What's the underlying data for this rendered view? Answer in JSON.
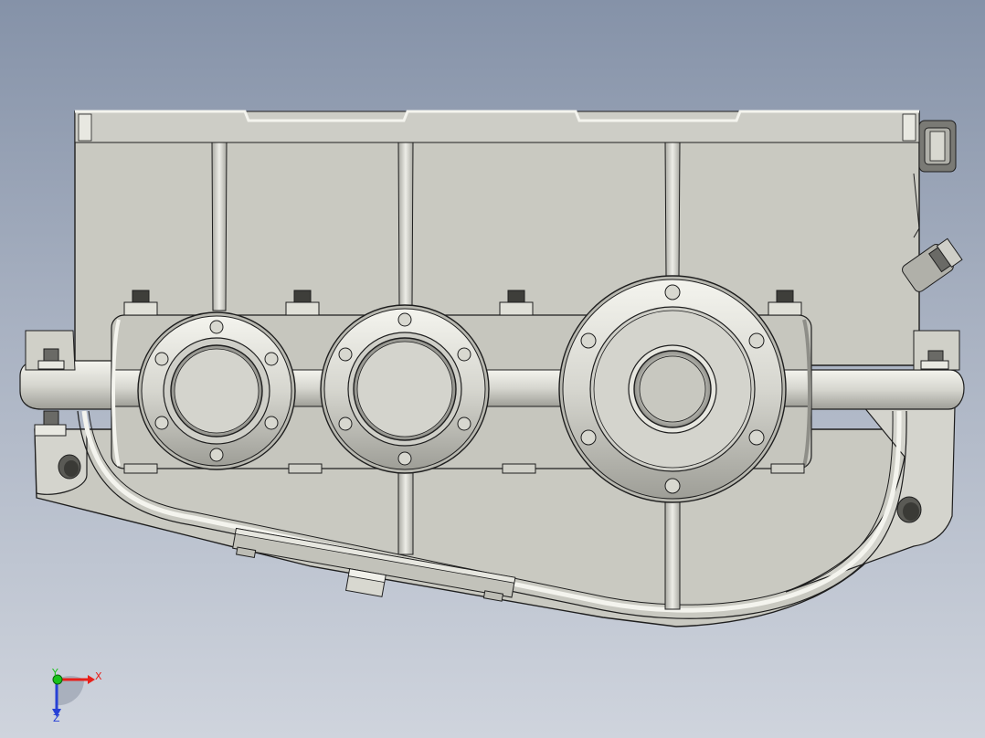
{
  "viewport": {
    "background_top": "#8592a8",
    "background_bottom": "#cfd4dd"
  },
  "model": {
    "body_color": "#c9c9c1",
    "edge_color": "#1e1e1e",
    "highlight_color": "#f2f2ec",
    "shadow_color": "#9d9d96"
  },
  "triad": {
    "x_label": "X",
    "y_label": "Y",
    "z_label": "Z",
    "x_color": "#e8201a",
    "y_color": "#18c21a",
    "z_color": "#2741d6"
  }
}
